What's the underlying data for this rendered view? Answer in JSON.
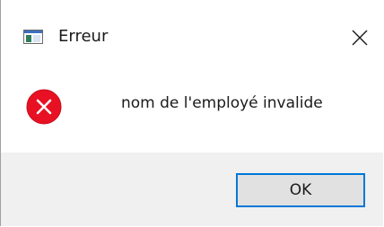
{
  "window": {
    "title": "Erreur",
    "app_icon": "application-window-icon",
    "close_icon": "close-icon"
  },
  "message": {
    "icon": "error-icon",
    "text": "nom de l'employé invalide"
  },
  "buttons": {
    "ok_label": "OK"
  },
  "colors": {
    "error_red": "#e81123",
    "focus_blue": "#0078d7",
    "footer_bg": "#f0f0f0"
  }
}
